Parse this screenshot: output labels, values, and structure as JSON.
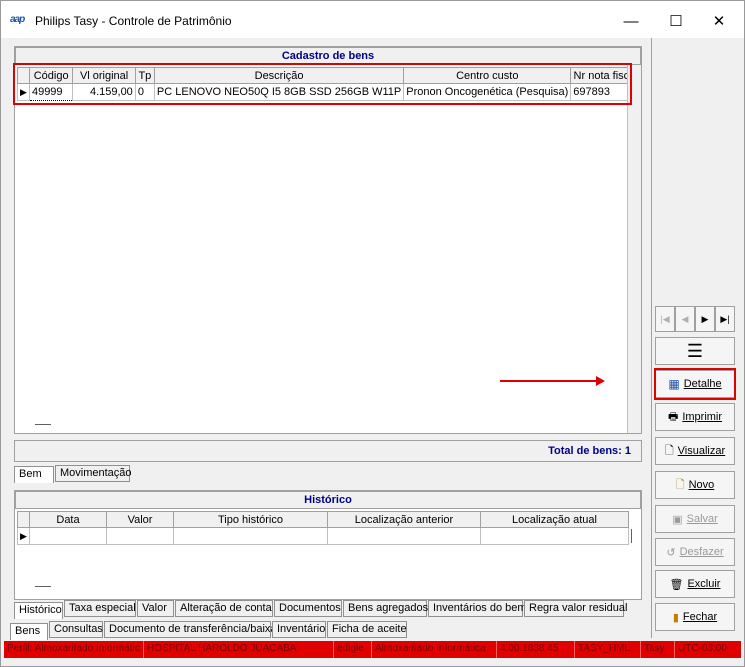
{
  "window": {
    "logo": "aap",
    "title": "Philips Tasy - Controle de Patrimônio",
    "minimize": "—",
    "maximize": "☐",
    "close": "✕"
  },
  "cadastro": {
    "title": "Cadastro de bens",
    "columns": [
      "Código",
      "Vl original",
      "Tp",
      "Descrição",
      "Centro custo",
      "Nr nota fiscal"
    ],
    "rows": [
      {
        "codigo": "49999",
        "vl_original": "4.159,00",
        "tp": "0",
        "descricao": "PC LENOVO NEO50Q I5 8GB SSD 256GB W11P",
        "centro_custo": "Pronon Oncogenética (Pesquisa)",
        "nr_nota_fiscal": "697893"
      }
    ],
    "total_label": "Total de bens: 1"
  },
  "main_tabs": [
    "Bem",
    "Movimentação"
  ],
  "historico": {
    "title": "Histórico",
    "columns": [
      "Data",
      "Valor",
      "Tipo histórico",
      "Localização anterior",
      "Localização atual"
    ]
  },
  "detail_tabs": [
    "Histórico",
    "Taxa especial",
    "Valor",
    "Alteração de conta",
    "Documentos",
    "Bens agregados",
    "Inventários do bem",
    "Regra valor residual"
  ],
  "bottom_tabs": [
    "Bens",
    "Consultas",
    "Documento de transferência/baixa",
    "Inventário",
    "Ficha de aceite"
  ],
  "side_buttons": {
    "detalhe": "Detalhe",
    "imprimir": "Imprimir",
    "visualizar": "Visualizar",
    "novo": "Novo",
    "salvar": "Salvar",
    "desfazer": "Desfazer",
    "excluir": "Excluir",
    "fechar": "Fechar"
  },
  "status_bar": [
    "Perfil: Almoxarifado Informátic",
    "HOSPITAL HAROLDO JUACABA",
    "edigle",
    "Almoxarifado Informática",
    "4.00.1838.45",
    "TASY_HML",
    "Tasy",
    "UTC-03:00"
  ],
  "colors": {
    "accent_red": "#e00000",
    "title_blue": "#00008b"
  }
}
